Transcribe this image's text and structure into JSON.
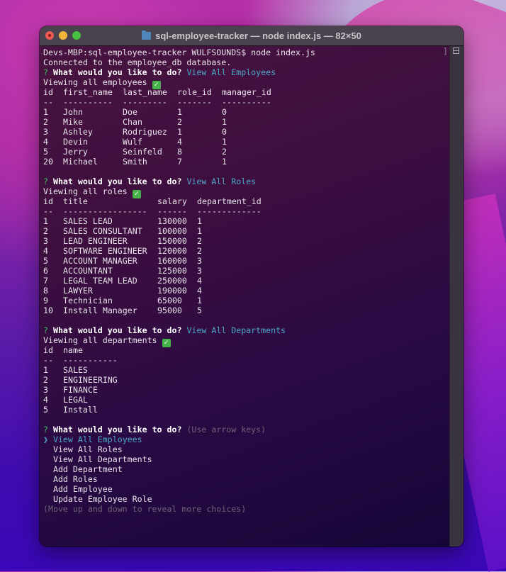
{
  "window": {
    "title": "sql-employee-tracker — node index.js — 82×50",
    "title_icon": "folder-icon",
    "controls": [
      "close",
      "minimize",
      "maximize"
    ]
  },
  "terminal": {
    "command_line": "Devs-MBP:sql-employee-tracker WULFSOUNDS$ node index.js",
    "connected_message": "Connected to the employee_db database.",
    "prompt_symbol": "?",
    "question": "What would you like to do?",
    "check_glyph": "✓",
    "employees_section": {
      "answer": "View All Employees",
      "viewing_message": "Viewing all employees",
      "headers": [
        "id",
        "first_name",
        "last_name",
        "role_id",
        "manager_id"
      ],
      "separators": [
        "--",
        "----------",
        "---------",
        "-------",
        "----------"
      ],
      "rows": [
        [
          "1",
          "John",
          "Doe",
          "1",
          "0"
        ],
        [
          "2",
          "Mike",
          "Chan",
          "2",
          "1"
        ],
        [
          "3",
          "Ashley",
          "Rodriguez",
          "1",
          "0"
        ],
        [
          "4",
          "Devin",
          "Wulf",
          "4",
          "1"
        ],
        [
          "5",
          "Jerry",
          "Seinfeld",
          "8",
          "2"
        ],
        [
          "20",
          "Michael",
          "Smith",
          "7",
          "1"
        ]
      ]
    },
    "roles_section": {
      "answer": "View All Roles",
      "viewing_message": "Viewing all roles",
      "headers": [
        "id",
        "title",
        "salary",
        "department_id"
      ],
      "separators": [
        "--",
        "-----------------",
        "------",
        "-------------"
      ],
      "rows": [
        [
          "1",
          "SALES LEAD",
          "130000",
          "1"
        ],
        [
          "2",
          "SALES CONSULTANT",
          "100000",
          "1"
        ],
        [
          "3",
          "LEAD ENGINEER",
          "150000",
          "2"
        ],
        [
          "4",
          "SOFTWARE ENGINEER",
          "120000",
          "2"
        ],
        [
          "5",
          "ACCOUNT MANAGER",
          "160000",
          "3"
        ],
        [
          "6",
          "ACCOUNTANT",
          "125000",
          "3"
        ],
        [
          "7",
          "LEGAL TEAM LEAD",
          "250000",
          "4"
        ],
        [
          "8",
          "LAWYER",
          "190000",
          "4"
        ],
        [
          "9",
          "Technician",
          "65000",
          "1"
        ],
        [
          "10",
          "Install Manager",
          "95000",
          "5"
        ]
      ]
    },
    "departments_section": {
      "answer": "View All Departments",
      "viewing_message": "Viewing all departments",
      "headers": [
        "id",
        "name"
      ],
      "separators": [
        "--",
        "-----------"
      ],
      "rows": [
        [
          "1",
          "SALES"
        ],
        [
          "2",
          "ENGINEERING"
        ],
        [
          "3",
          "FINANCE"
        ],
        [
          "4",
          "LEGAL"
        ],
        [
          "5",
          "Install"
        ]
      ]
    },
    "menu": {
      "hint": "(Use arrow keys)",
      "pointer": "❯",
      "selected_index": 0,
      "choices": [
        "View All Employees",
        "View All Roles",
        "View All Departments",
        "Add Department",
        "Add Roles",
        "Add Employee",
        "Update Employee Role"
      ],
      "footer_hint": "(Move up and down to reveal more choices)"
    }
  }
}
